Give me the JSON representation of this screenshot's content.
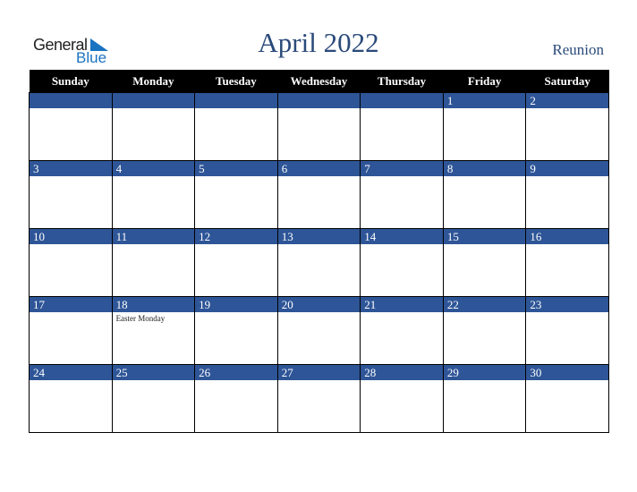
{
  "logo": {
    "line1": "General",
    "line2": "Blue"
  },
  "header": {
    "title": "April 2022",
    "country": "Reunion"
  },
  "colors": {
    "band": "#2e5597",
    "header_bg": "#000000",
    "title": "#2a4a7a",
    "logo_blue": "#1a73c0"
  },
  "weekdays": [
    "Sunday",
    "Monday",
    "Tuesday",
    "Wednesday",
    "Thursday",
    "Friday",
    "Saturday"
  ],
  "weeks": [
    [
      {
        "day": ""
      },
      {
        "day": ""
      },
      {
        "day": ""
      },
      {
        "day": ""
      },
      {
        "day": ""
      },
      {
        "day": "1"
      },
      {
        "day": "2"
      }
    ],
    [
      {
        "day": "3"
      },
      {
        "day": "4"
      },
      {
        "day": "5"
      },
      {
        "day": "6"
      },
      {
        "day": "7"
      },
      {
        "day": "8"
      },
      {
        "day": "9"
      }
    ],
    [
      {
        "day": "10"
      },
      {
        "day": "11"
      },
      {
        "day": "12"
      },
      {
        "day": "13"
      },
      {
        "day": "14"
      },
      {
        "day": "15"
      },
      {
        "day": "16"
      }
    ],
    [
      {
        "day": "17"
      },
      {
        "day": "18",
        "event": "Easter Monday"
      },
      {
        "day": "19"
      },
      {
        "day": "20"
      },
      {
        "day": "21"
      },
      {
        "day": "22"
      },
      {
        "day": "23"
      }
    ],
    [
      {
        "day": "24"
      },
      {
        "day": "25"
      },
      {
        "day": "26"
      },
      {
        "day": "27"
      },
      {
        "day": "28"
      },
      {
        "day": "29"
      },
      {
        "day": "30"
      }
    ]
  ]
}
